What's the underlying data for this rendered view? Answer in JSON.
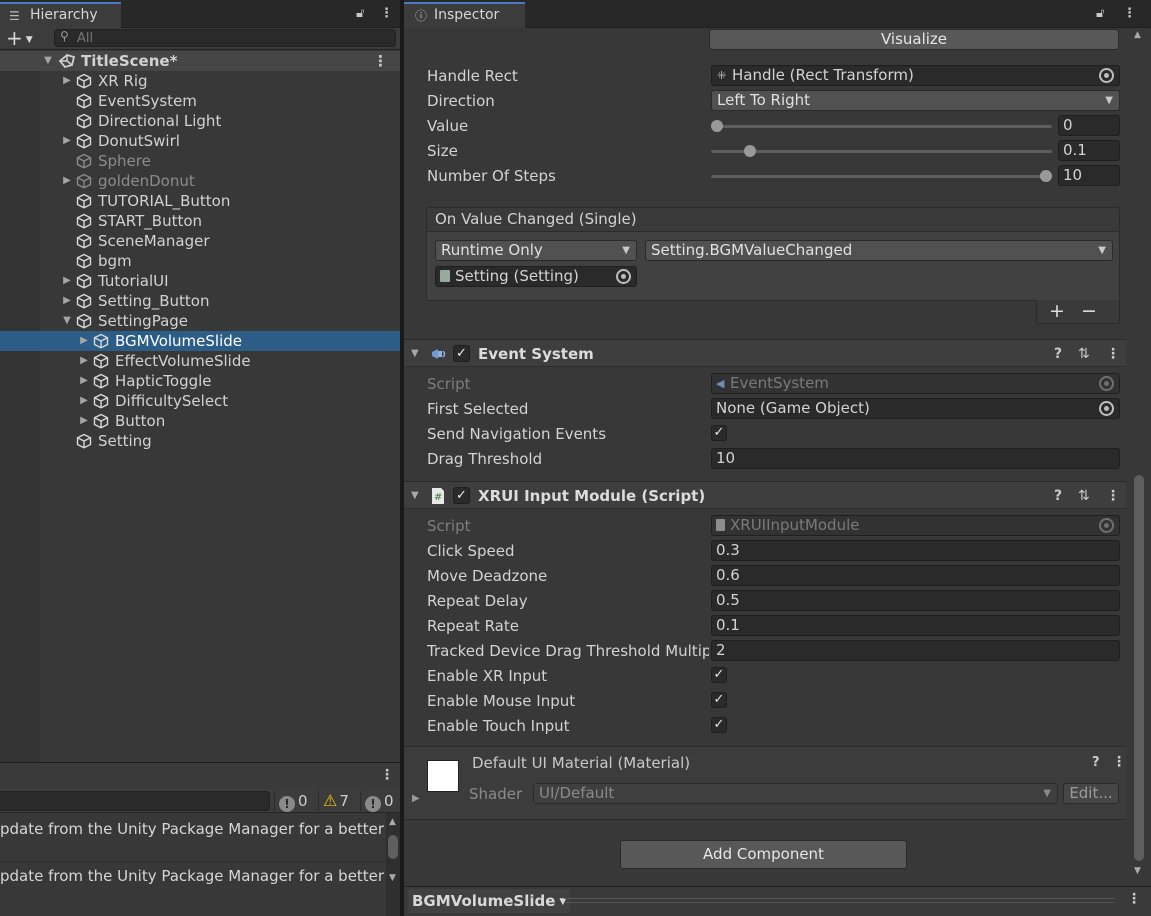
{
  "hierarchy": {
    "tab_title": "Hierarchy",
    "add_label": "+",
    "search_placeholder": "All",
    "scene_name": "TitleScene*",
    "items": [
      {
        "label": "XR Rig",
        "depth": 1,
        "expand": true,
        "dim": false,
        "selected": false
      },
      {
        "label": "EventSystem",
        "depth": 1,
        "expand": false,
        "dim": false,
        "selected": false
      },
      {
        "label": "Directional Light",
        "depth": 1,
        "expand": false,
        "dim": false,
        "selected": false
      },
      {
        "label": "DonutSwirl",
        "depth": 1,
        "expand": true,
        "dim": false,
        "selected": false
      },
      {
        "label": "Sphere",
        "depth": 1,
        "expand": false,
        "dim": true,
        "selected": false
      },
      {
        "label": "goldenDonut",
        "depth": 1,
        "expand": true,
        "dim": true,
        "selected": false
      },
      {
        "label": "TUTORIAL_Button",
        "depth": 1,
        "expand": false,
        "dim": false,
        "selected": false
      },
      {
        "label": "START_Button",
        "depth": 1,
        "expand": false,
        "dim": false,
        "selected": false
      },
      {
        "label": "SceneManager",
        "depth": 1,
        "expand": false,
        "dim": false,
        "selected": false
      },
      {
        "label": "bgm",
        "depth": 1,
        "expand": false,
        "dim": false,
        "selected": false
      },
      {
        "label": "TutorialUI",
        "depth": 1,
        "expand": true,
        "dim": false,
        "selected": false
      },
      {
        "label": "Setting_Button",
        "depth": 1,
        "expand": true,
        "dim": false,
        "selected": false
      },
      {
        "label": "SettingPage",
        "depth": 1,
        "expand": "open",
        "dim": false,
        "selected": false
      },
      {
        "label": "BGMVolumeSlide",
        "depth": 2,
        "expand": true,
        "dim": false,
        "selected": true
      },
      {
        "label": "EffectVolumeSlide",
        "depth": 2,
        "expand": true,
        "dim": false,
        "selected": false
      },
      {
        "label": "HapticToggle",
        "depth": 2,
        "expand": true,
        "dim": false,
        "selected": false
      },
      {
        "label": "DifficultySelect",
        "depth": 2,
        "expand": true,
        "dim": false,
        "selected": false
      },
      {
        "label": "Button",
        "depth": 2,
        "expand": true,
        "dim": false,
        "selected": false
      },
      {
        "label": "Setting",
        "depth": 1,
        "expand": false,
        "dim": false,
        "selected": false
      }
    ]
  },
  "console": {
    "info_count": "0",
    "warning_count": "7",
    "error_count": "0",
    "messages": [
      "pdate from the Unity Package Manager for a better Vis",
      "pdate from the Unity Package Manager for a better Vis"
    ]
  },
  "inspector": {
    "tab_title": "Inspector",
    "visualize_label": "Visualize",
    "scrollbar": {
      "handle_rect_label": "Handle Rect",
      "handle_rect_value": "Handle (Rect Transform)",
      "direction_label": "Direction",
      "direction_value": "Left To Right",
      "value_label": "Value",
      "value": "0",
      "value_fraction": 0.0,
      "size_label": "Size",
      "size": "0.1",
      "size_fraction": 0.1,
      "steps_label": "Number Of Steps",
      "steps": "10",
      "steps_fraction": 1.0
    },
    "event": {
      "header": "On Value Changed (Single)",
      "runtime_mode": "Runtime Only",
      "function": "Setting.BGMValueChanged",
      "target": "Setting (Setting)",
      "add_label": "+",
      "remove_label": "−"
    },
    "event_system": {
      "title": "Event System",
      "enabled": true,
      "script_label": "Script",
      "script_value": "EventSystem",
      "first_selected_label": "First Selected",
      "first_selected_value": "None (Game Object)",
      "send_nav_label": "Send Navigation Events",
      "send_nav": true,
      "drag_threshold_label": "Drag Threshold",
      "drag_threshold": "10"
    },
    "xrui": {
      "title": "XRUI Input Module (Script)",
      "enabled": true,
      "script_label": "Script",
      "script_value": "XRUIInputModule",
      "click_speed_label": "Click Speed",
      "click_speed": "0.3",
      "move_deadzone_label": "Move Deadzone",
      "move_deadzone": "0.6",
      "repeat_delay_label": "Repeat Delay",
      "repeat_delay": "0.5",
      "repeat_rate_label": "Repeat Rate",
      "repeat_rate": "0.1",
      "tracked_label": "Tracked Device Drag Threshold Multipl",
      "tracked": "2",
      "xr_input_label": "Enable XR Input",
      "mouse_input_label": "Enable Mouse Input",
      "touch_input_label": "Enable Touch Input"
    },
    "material": {
      "title": "Default UI Material (Material)",
      "shader_label": "Shader",
      "shader_value": "UI/Default",
      "edit_label": "Edit..."
    },
    "add_component_label": "Add Component",
    "footer_object": "BGMVolumeSlide"
  },
  "colors": {
    "selection": "#2c5d87",
    "tab_accent": "#4d79c4",
    "panel": "#383838",
    "warning": "#f4c20d"
  }
}
